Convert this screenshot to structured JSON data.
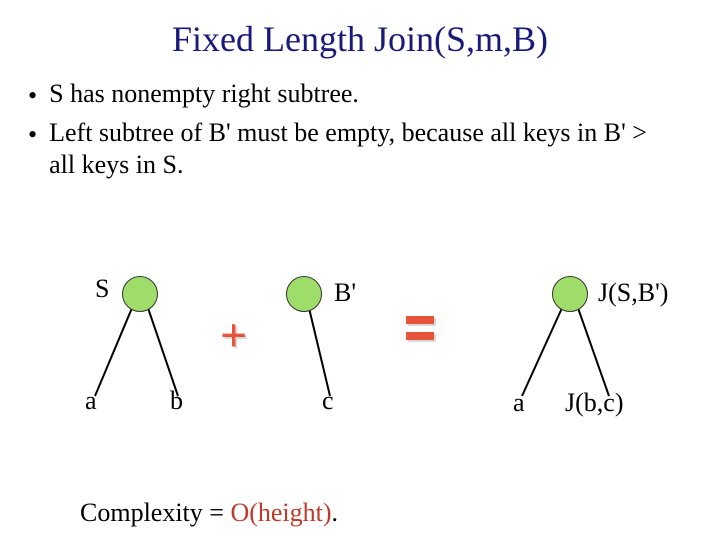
{
  "title": "Fixed Length Join(S,m,B)",
  "bullets": [
    "S has nonempty right subtree.",
    "Left subtree of B' must be empty, because all keys in B' > all keys in S."
  ],
  "labels": {
    "S": "S",
    "Bprime": "B'",
    "a1": "a",
    "b": "b",
    "c": "c",
    "JSB": "J(S,B')",
    "a2": "a",
    "Jbc": "J(b,c)"
  },
  "complexity": {
    "prefix": "Complexity = ",
    "value": "O(height)",
    "suffix": "."
  }
}
